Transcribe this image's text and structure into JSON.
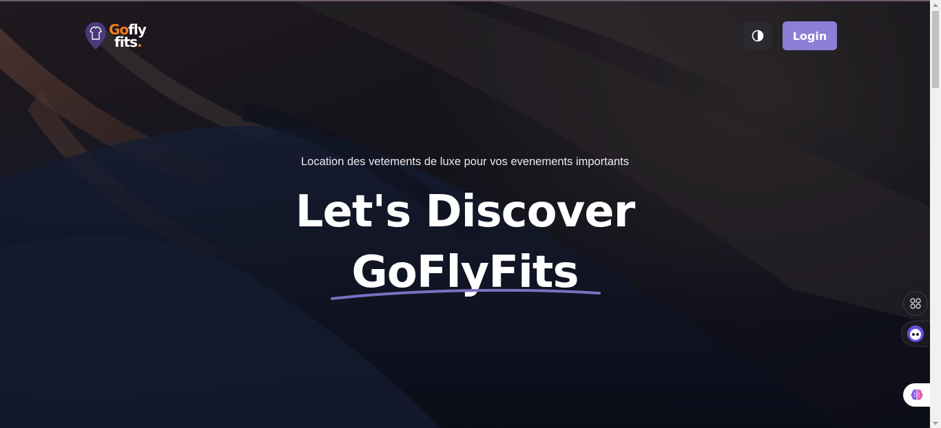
{
  "brand": {
    "logo_go": "Go",
    "logo_fly": "fly",
    "logo_fits": "fits",
    "logo_dot": ".",
    "accent": "#8b7fd6",
    "orange": "#f47b20"
  },
  "header": {
    "theme_toggle_icon": "contrast-icon",
    "login_label": "Login"
  },
  "hero": {
    "subtitle": "Location des vetements de luxe pour vos evenements importants",
    "headline_line1": "Let's Discover",
    "headline_line2": "GoFlyFits"
  },
  "side_tools": [
    {
      "icon": "apps-grid-icon"
    },
    {
      "icon": "bot-face-icon"
    },
    {
      "icon": "brain-icon"
    }
  ]
}
